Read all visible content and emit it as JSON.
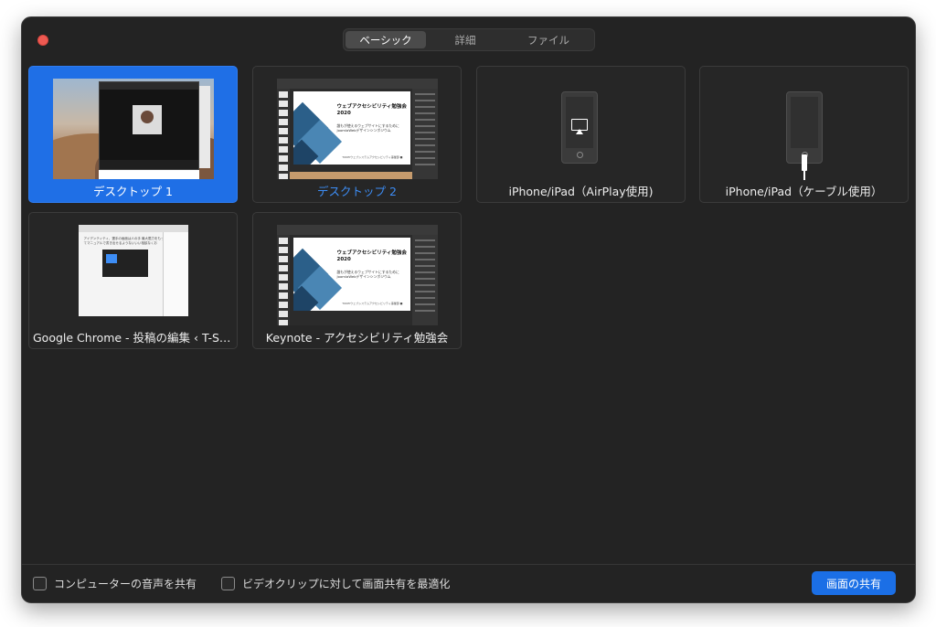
{
  "tabs": [
    {
      "label": "ベーシック",
      "active": true
    },
    {
      "label": "詳細",
      "active": false
    },
    {
      "label": "ファイル",
      "active": false
    }
  ],
  "tiles": [
    {
      "label": "デスクトップ 1",
      "selected": true
    },
    {
      "label": "デスクトップ 2",
      "selected": false
    },
    {
      "label": "iPhone/iPad（AirPlay使用)",
      "selected": false
    },
    {
      "label": "iPhone/iPad（ケーブル使用）",
      "selected": false
    },
    {
      "label": "Google Chrome - 投稿の編集 ‹ T-ST...",
      "selected": false
    },
    {
      "label": "Keynote - アクセシビリティ勉強会",
      "selected": false
    }
  ],
  "slide": {
    "title": "ウェブアクセシビリティ勉強会",
    "year": "2020",
    "subtitle": "誰もが使えるウェブサイトにするために",
    "sub2": "JoomlaWebデザインシンポジウム",
    "footer": "TOKEIウェブシステムアクセシビリティ事業部 ■"
  },
  "chrome_thumb": {
    "text": "アイデンティティ、選手の画面は人の手 最大限力をもってマニュアルで書き出せるようないいい相談なくお"
  },
  "footer": {
    "audio_label": "コンピューターの音声を共有",
    "optimize_label": "ビデオクリップに対して画面共有を最適化",
    "share_button": "画面の共有"
  },
  "colors": {
    "accent": "#1b6fe6",
    "close": "#ee5a52",
    "background": "#232323"
  }
}
